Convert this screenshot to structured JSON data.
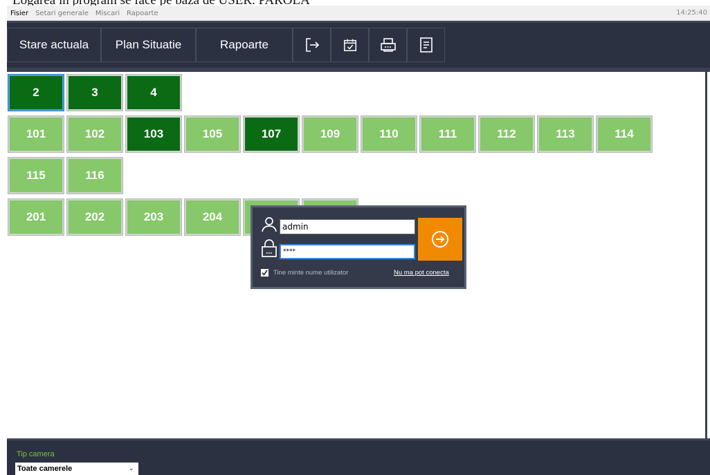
{
  "caption": "Logarea in program se face pe baza de USER. PAROLA",
  "menu": {
    "items": [
      "Fisier",
      "Setari generale",
      "Miscari",
      "Rapoarte"
    ],
    "clock": "14:25:40"
  },
  "nav": {
    "tabs": [
      "Stare actuala",
      "Plan Situatie",
      "Rapoarte"
    ],
    "icons": [
      "logout-icon",
      "calendar-check-icon",
      "printer-icon",
      "document-icon"
    ]
  },
  "rooms": {
    "row1": [
      {
        "label": "2",
        "status": "occupied",
        "selected": true
      },
      {
        "label": "3",
        "status": "occupied"
      },
      {
        "label": "4",
        "status": "occupied"
      }
    ],
    "row2": [
      {
        "label": "101",
        "status": "free"
      },
      {
        "label": "102",
        "status": "free"
      },
      {
        "label": "103",
        "status": "occupied"
      },
      {
        "label": "105",
        "status": "free"
      },
      {
        "label": "107",
        "status": "occupied"
      },
      {
        "label": "109",
        "status": "free"
      },
      {
        "label": "110",
        "status": "free"
      },
      {
        "label": "111",
        "status": "free"
      },
      {
        "label": "112",
        "status": "free"
      },
      {
        "label": "113",
        "status": "free"
      },
      {
        "label": "114",
        "status": "free"
      }
    ],
    "row3": [
      {
        "label": "115",
        "status": "free"
      },
      {
        "label": "116",
        "status": "free"
      }
    ],
    "row4": [
      {
        "label": "201",
        "status": "free"
      },
      {
        "label": "202",
        "status": "free"
      },
      {
        "label": "203",
        "status": "free"
      },
      {
        "label": "204",
        "status": "free"
      },
      {
        "label": "",
        "status": "free"
      },
      {
        "label": "",
        "status": "free"
      }
    ]
  },
  "login": {
    "username_value": "admin",
    "password_value": "****",
    "remember_label": "Tine minte nume utilizator",
    "remember_checked": true,
    "cant_connect_label": "Nu ma pot conecta"
  },
  "footer": {
    "label": "Tip camera",
    "select_value": "Toate camerele"
  },
  "colors": {
    "free": "#86c86a",
    "occupied": "#0b6b15",
    "nav_bg": "#2c3142",
    "login_button": "#f18a00",
    "footer_label": "#7cc241"
  }
}
